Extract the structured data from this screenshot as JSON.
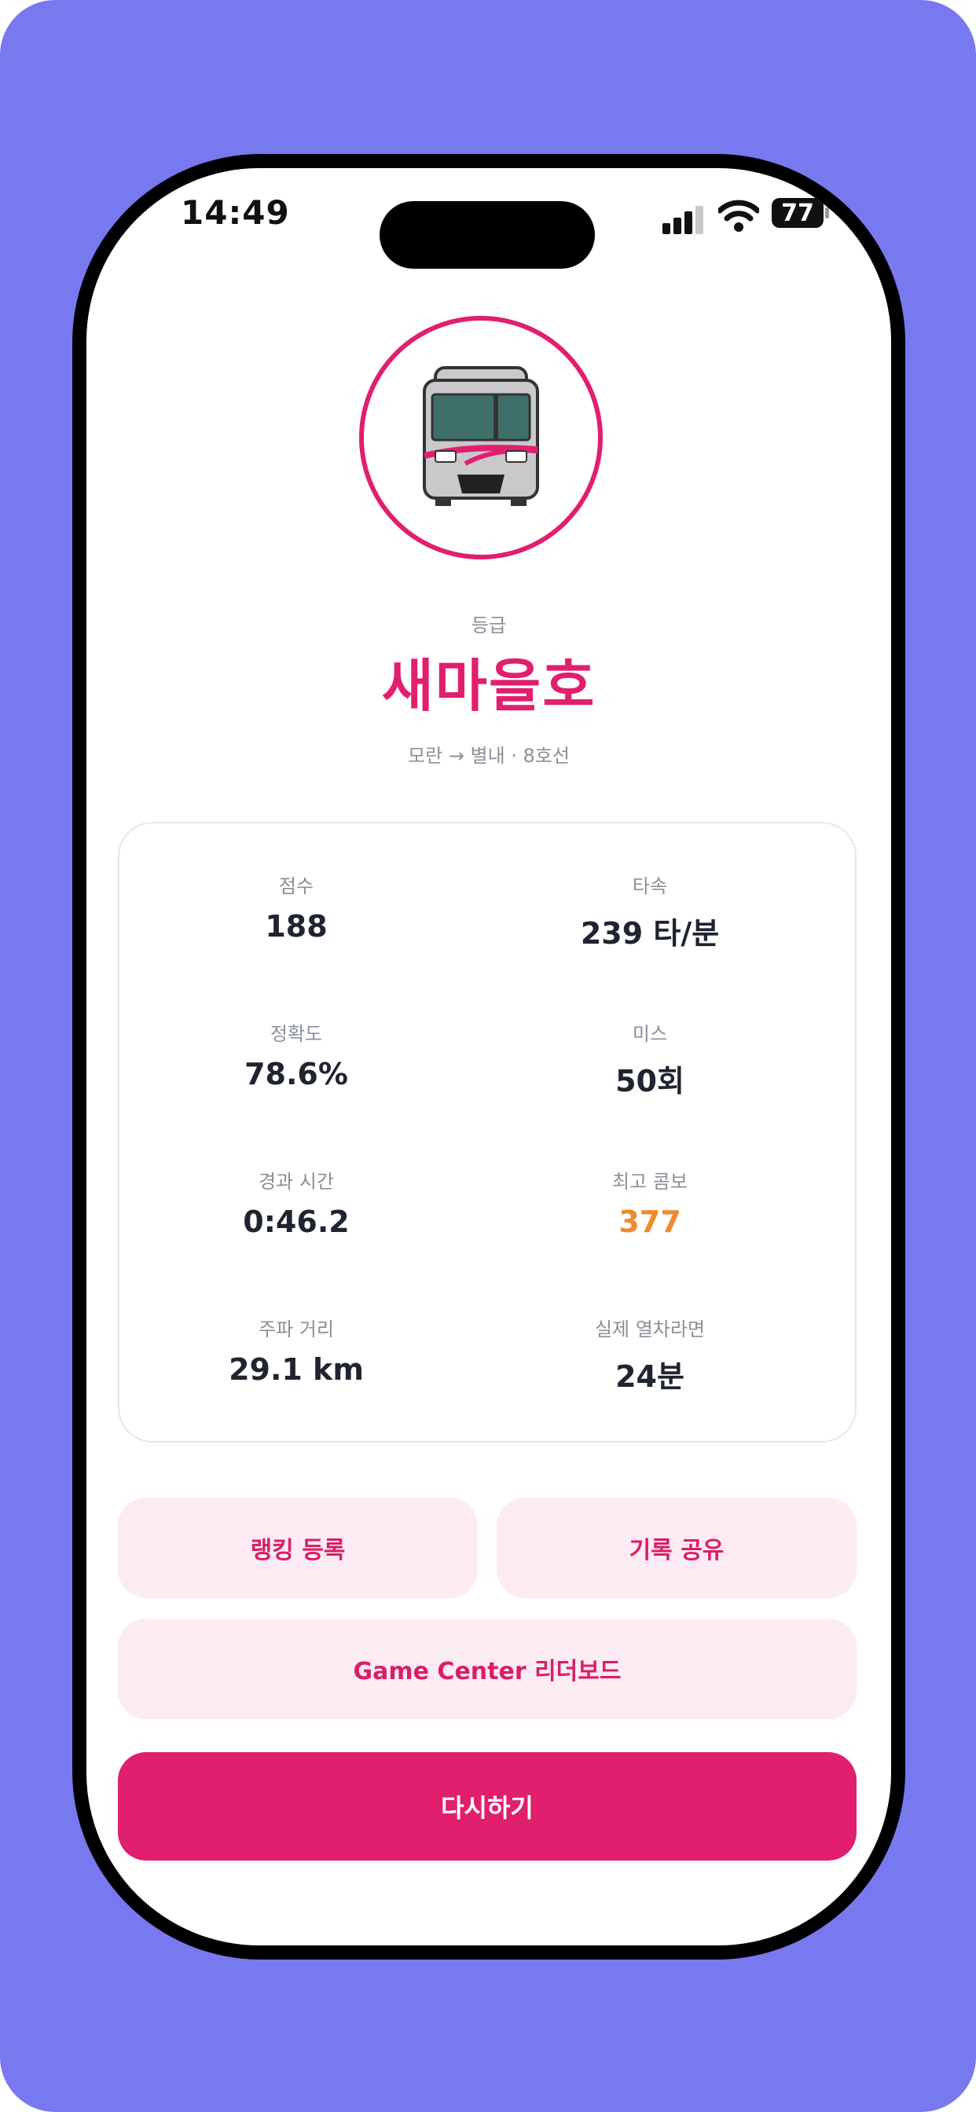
{
  "status_bar": {
    "time": "14:49",
    "battery": "77"
  },
  "result": {
    "grade_label": "등급",
    "grade": "새마을호",
    "route": "모란 → 별내 · 8호선",
    "accent_color": "#e01f6e"
  },
  "stats": [
    {
      "label": "점수",
      "value": "188"
    },
    {
      "label": "타속",
      "value": "239 타/분"
    },
    {
      "label": "정확도",
      "value": "78.6%"
    },
    {
      "label": "미스",
      "value": "50회"
    },
    {
      "label": "경과 시간",
      "value": "0:46.2"
    },
    {
      "label": "최고 콤보",
      "value": "377",
      "color": "#ef8a2e"
    },
    {
      "label": "주파 거리",
      "value": "29.1 km"
    },
    {
      "label": "실제 열차라면",
      "value": "24분"
    }
  ],
  "actions": {
    "ranking": "랭킹 등록",
    "share": "기록 공유",
    "leaderboard": "Game Center 리더보드",
    "retry": "다시하기"
  }
}
